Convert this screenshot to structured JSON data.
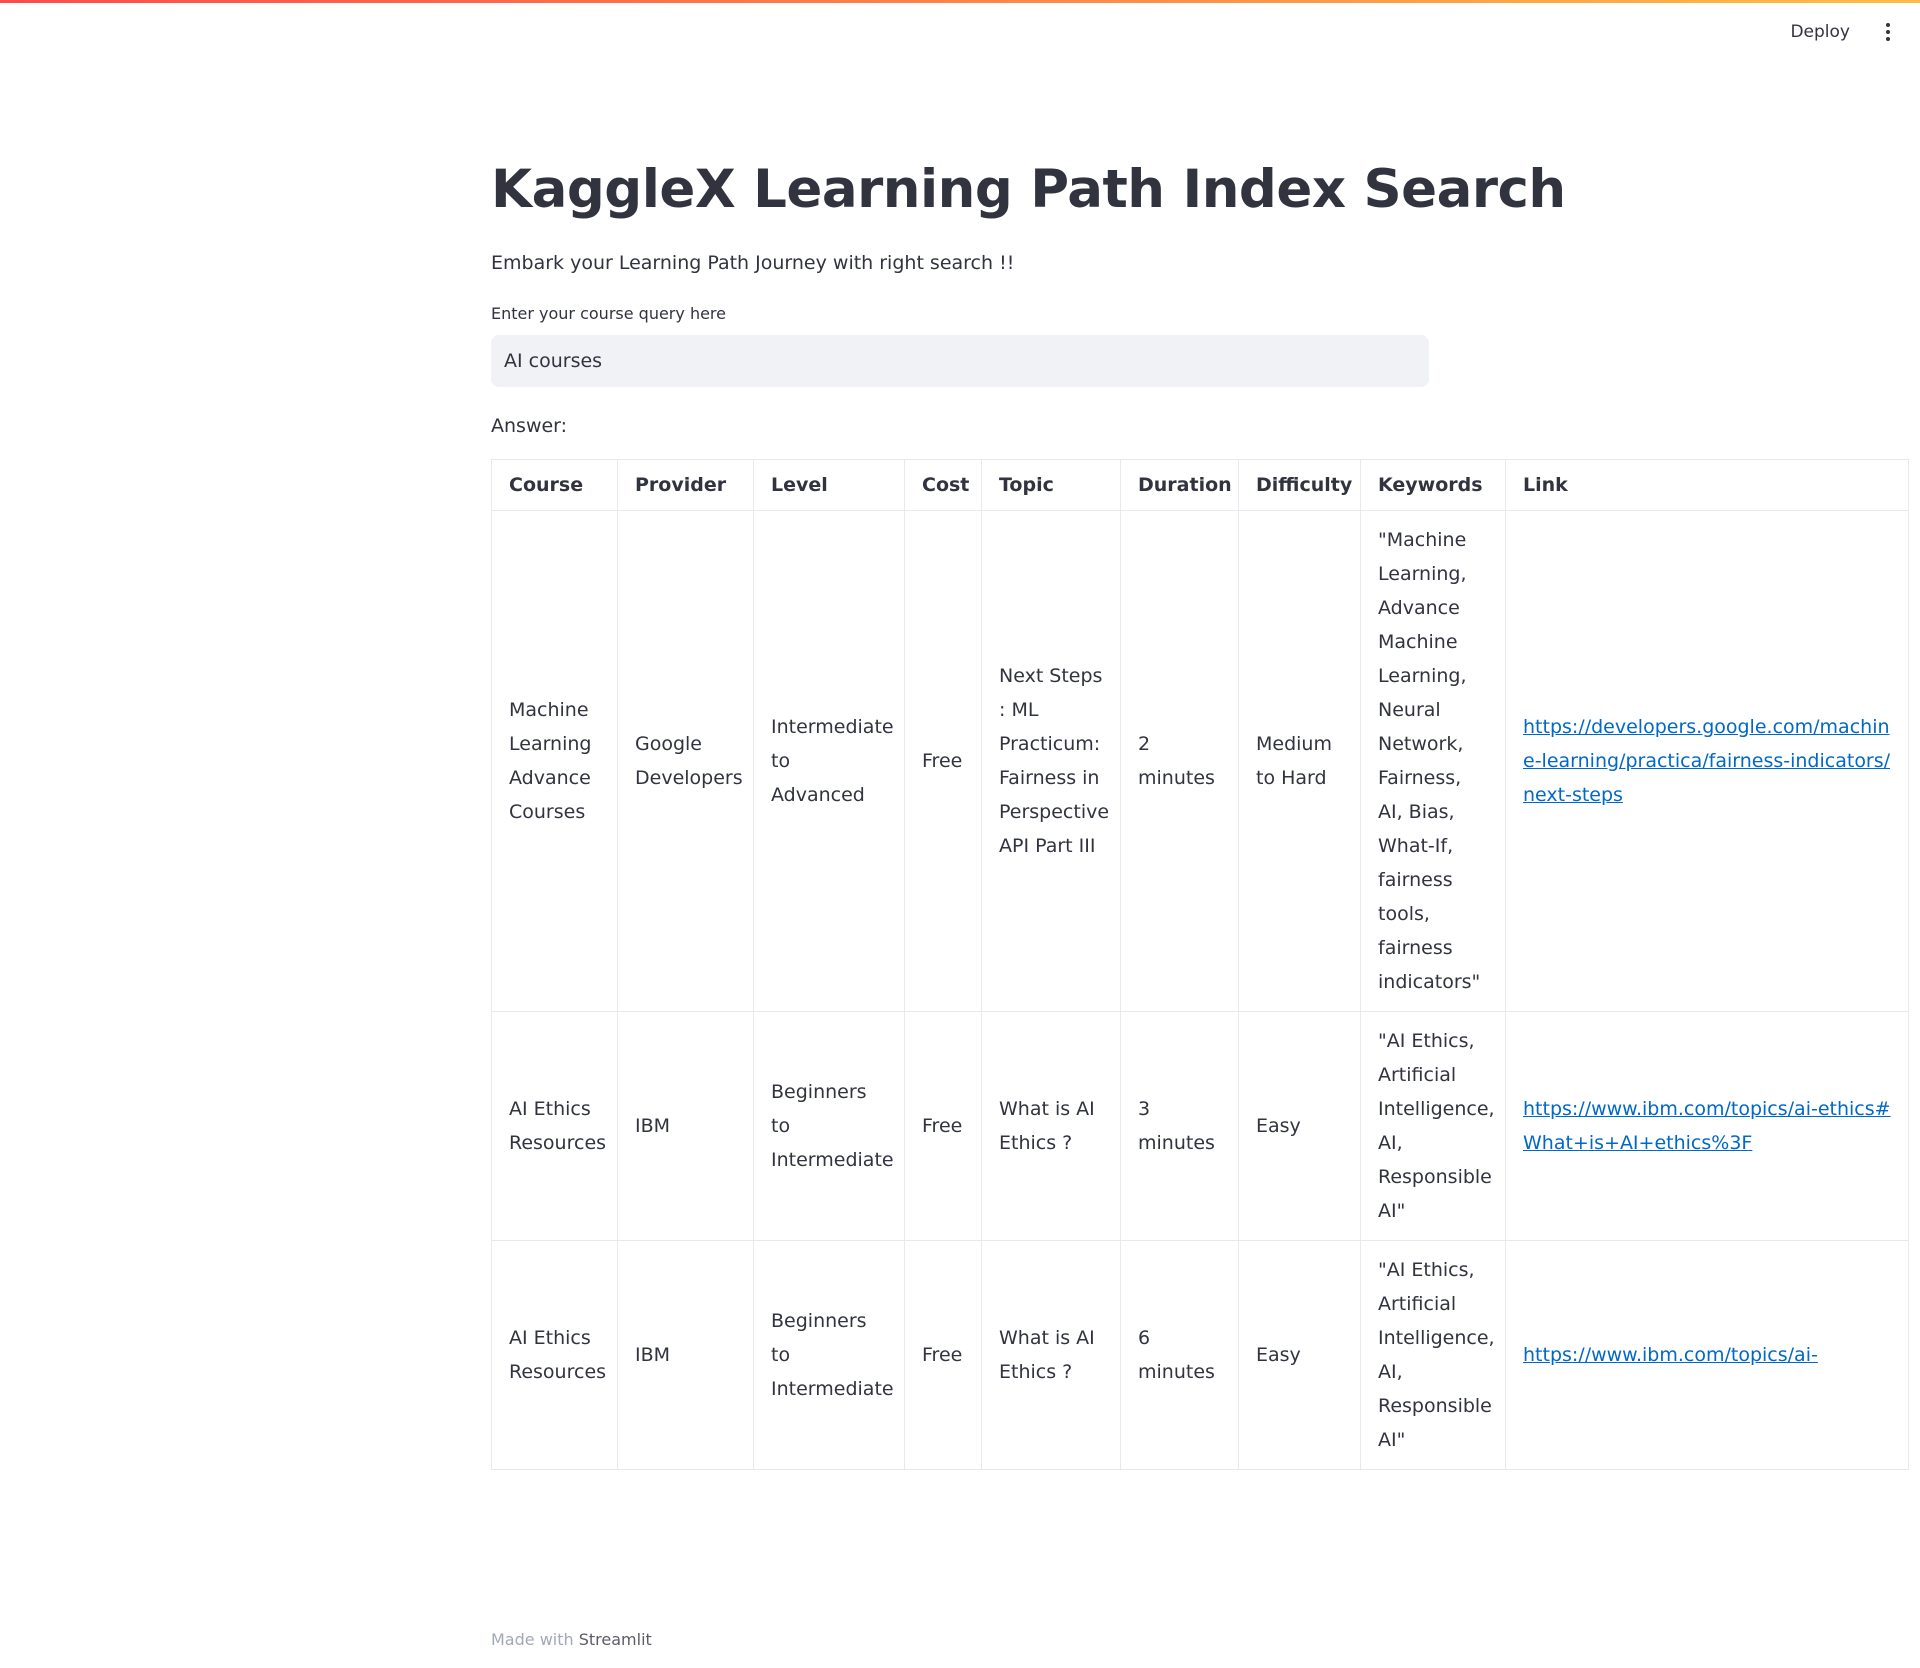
{
  "header": {
    "deploy_label": "Deploy"
  },
  "main": {
    "title": "KaggleX Learning Path Index Search",
    "subtitle": "Embark your Learning Path Journey with right search !!",
    "query_label": "Enter your course query here",
    "query_value": "AI courses",
    "answer_label": "Answer:"
  },
  "table": {
    "columns": [
      "Course",
      "Provider",
      "Level",
      "Cost",
      "Topic",
      "Duration",
      "Difficulty",
      "Keywords",
      "Link"
    ],
    "rows": [
      {
        "course": "Machine Learning Advance Courses",
        "provider": "Google Developers",
        "level": "Intermediate to Advanced",
        "cost": "Free",
        "topic": "Next Steps : ML Practicum: Fairness in Perspective API Part III",
        "duration": "2 minutes",
        "difficulty": "Medium to Hard",
        "keywords": "\"Machine Learning, Advance Machine Learning, Neural Network, Fairness, AI, Bias, What-If, fairness tools, fairness indicators\"",
        "link": "https://developers.google.com/machine-learning/practica/fairness-indicators/next-steps"
      },
      {
        "course": "AI Ethics Resources",
        "provider": "IBM",
        "level": "Beginners to Intermediate",
        "cost": "Free",
        "topic": "What is AI Ethics ?",
        "duration": "3 minutes",
        "difficulty": "Easy",
        "keywords": "\"AI Ethics, Artificial Intelligence, AI, Responsible AI\"",
        "link": "https://www.ibm.com/topics/ai-ethics#What+is+AI+ethics%3F"
      },
      {
        "course": "AI Ethics Resources",
        "provider": "IBM",
        "level": "Beginners to Intermediate",
        "cost": "Free",
        "topic": "What is AI Ethics ?",
        "duration": "6 minutes",
        "difficulty": "Easy",
        "keywords": "\"AI Ethics, Artificial Intelligence, AI, Responsible AI\"",
        "link": "https://www.ibm.com/topics/ai-"
      }
    ]
  },
  "footer": {
    "prefix": "Made with",
    "brand": "Streamlit"
  },
  "colors": {
    "text": "#31333f",
    "link": "#0068c9",
    "input_bg": "#f0f2f6",
    "border": "#e6e9ef",
    "gradient_start": "#ff4b4b",
    "gradient_end": "#ffbd45"
  },
  "icons": {
    "menu": "vertical-ellipsis-icon"
  }
}
